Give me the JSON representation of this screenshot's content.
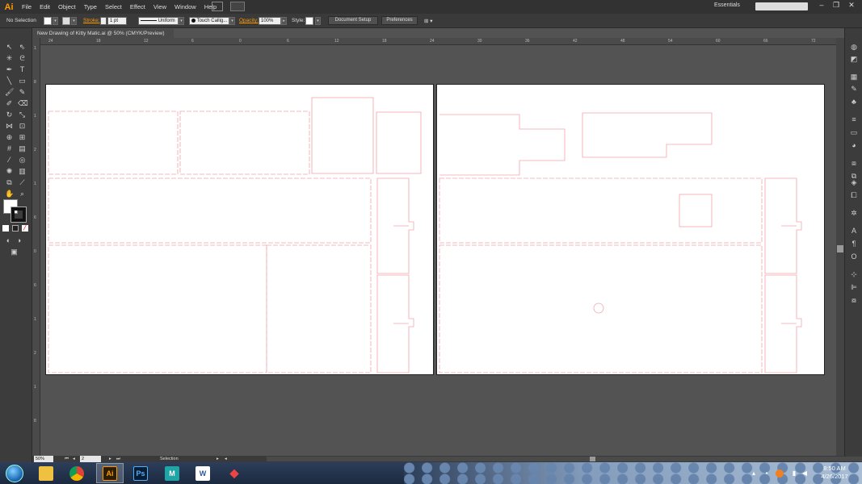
{
  "app": {
    "logo_text": "Ai",
    "menus": [
      "File",
      "Edit",
      "Object",
      "Type",
      "Select",
      "Effect",
      "View",
      "Window",
      "Help"
    ],
    "workspace": "Essentials",
    "accent_color": "#ff9a00"
  },
  "control_bar": {
    "selection_label": "No Selection",
    "stroke_label": "Stroke:",
    "stroke_weight": "1 pt",
    "stroke_profile": "Uniform",
    "brush": "Touch Callig...",
    "opacity_label": "Opacity:",
    "opacity_value": "100%",
    "style_label": "Style:",
    "document_setup": "Document Setup",
    "preferences": "Preferences"
  },
  "document": {
    "tab_title": "New Drawing of Kitty Matic.ai @ 50% (CMYK/Preview)",
    "ruler_h_labels": [
      "24",
      "18",
      "12",
      "6",
      "0",
      "6",
      "12",
      "18",
      "24",
      "30",
      "36",
      "42",
      "48",
      "54",
      "60",
      "66",
      "72"
    ],
    "ruler_v_labels": [
      "1",
      "8",
      "1",
      "2",
      "1",
      "6",
      "0",
      "6",
      "1",
      "2",
      "1",
      "8"
    ],
    "cut_line_color": "#f2a5aa"
  },
  "status_bar": {
    "zoom": "50%",
    "artboard_number": "2",
    "tool_name": "Selection"
  },
  "taskbar": {
    "apps": [
      {
        "icon": "folder-icon"
      },
      {
        "icon": "chrome-icon"
      },
      {
        "icon": "illustrator-icon",
        "label": "Ai"
      },
      {
        "icon": "photoshop-icon",
        "label": "Ps"
      },
      {
        "icon": "maya-icon"
      },
      {
        "icon": "word-icon",
        "label": "W"
      },
      {
        "icon": "app-diamond-icon"
      }
    ],
    "time": "8:50 AM",
    "date": "4/26/2017"
  }
}
